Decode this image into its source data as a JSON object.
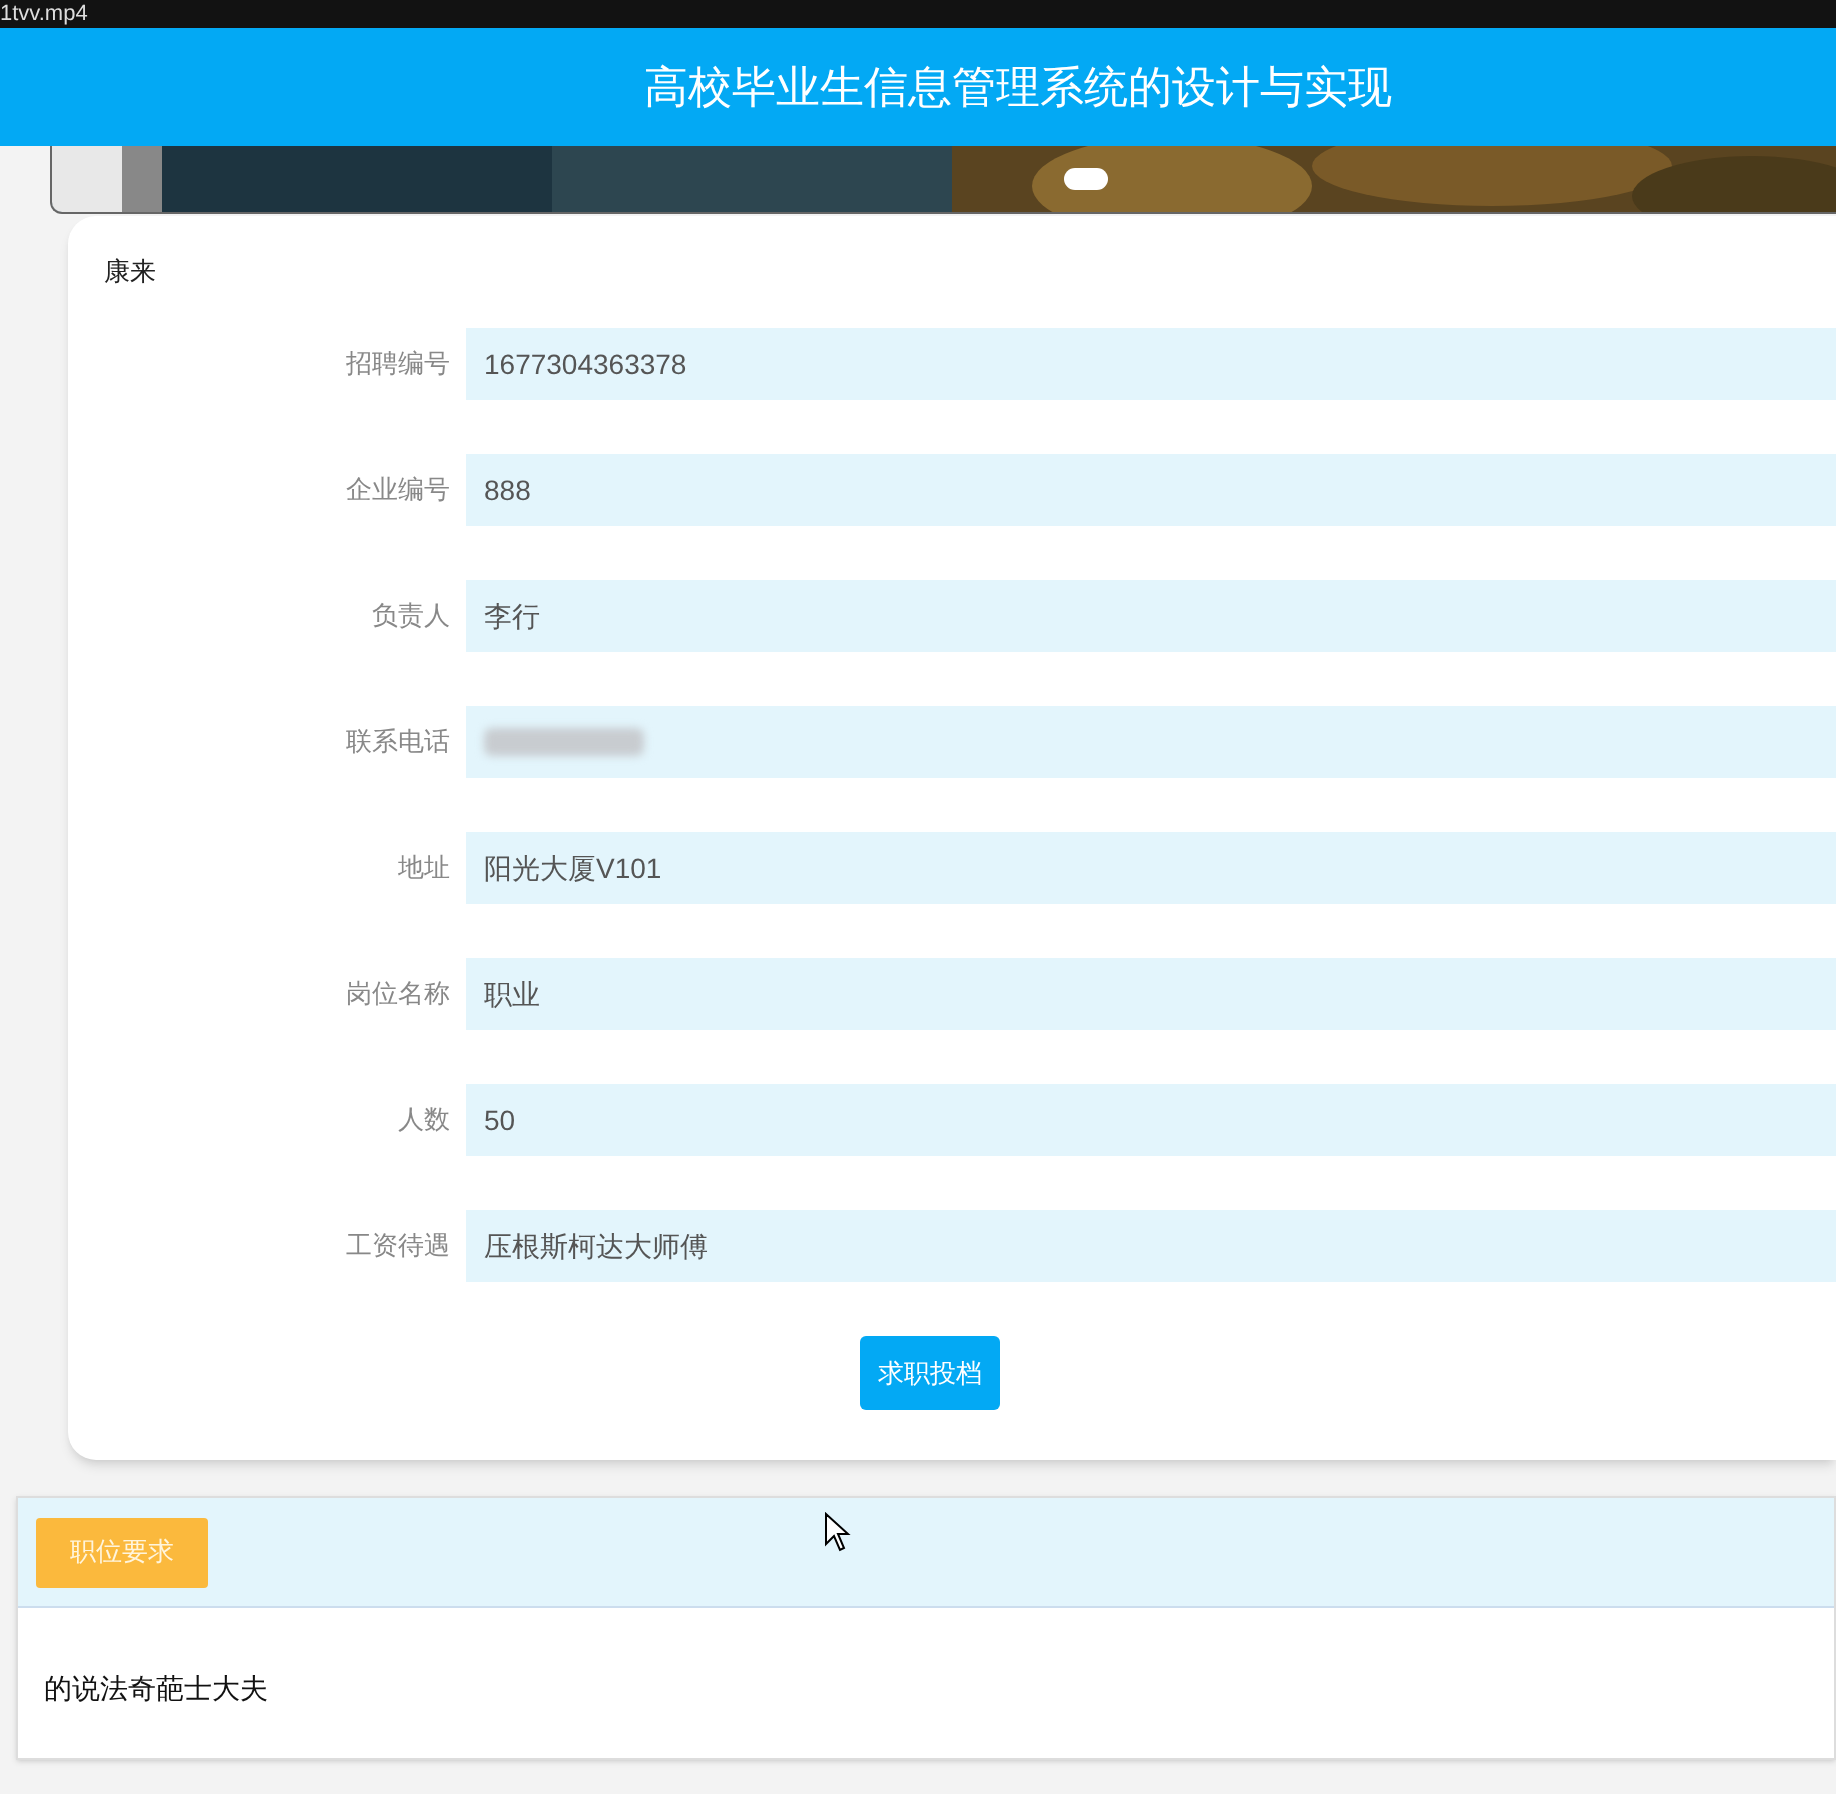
{
  "window": {
    "title": "1tvv.mp4"
  },
  "header": {
    "title": "高校毕业生信息管理系统的设计与实现"
  },
  "banner": {
    "slides": [
      {
        "selected": true
      }
    ]
  },
  "detail": {
    "title": "康来",
    "fields": [
      {
        "label": "招聘编号",
        "value": "1677304363378"
      },
      {
        "label": "企业编号",
        "value": "888"
      },
      {
        "label": "负责人",
        "value": "李行"
      },
      {
        "label": "联系电话",
        "redacted": true
      },
      {
        "label": "地址",
        "value": "阳光大厦V101"
      },
      {
        "label": "岗位名称",
        "value": "职业"
      },
      {
        "label": "人数",
        "value": "50"
      },
      {
        "label": "工资待遇",
        "value": "压根斯柯达大师傅"
      }
    ],
    "button": "求职投档"
  },
  "requirements": {
    "tab": "职位要求",
    "text": "的说法奇葩士大夫"
  }
}
